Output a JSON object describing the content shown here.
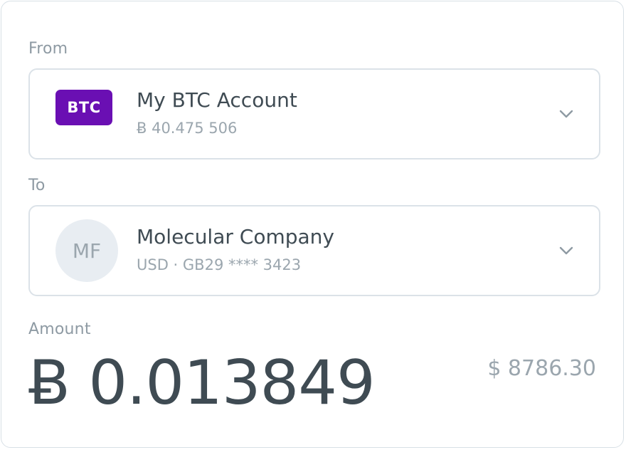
{
  "from": {
    "label": "From",
    "account_badge": "BTC",
    "account_name": "My BTC Account",
    "account_balance": "Ƀ 40.475 506",
    "chevron_icon": "chevron-down-icon"
  },
  "to": {
    "label": "To",
    "recipient_initials": "MF",
    "recipient_name": "Molecular Company",
    "recipient_details": "USD · GB29 **** 3423",
    "chevron_icon": "chevron-down-icon"
  },
  "amount": {
    "label": "Amount",
    "value": "Ƀ 0.013849",
    "fiat_equivalent": "$ 8786.30"
  },
  "colors": {
    "btc_badge": "#6a0fb3",
    "primary_text": "#3f4b53",
    "secondary_text": "#9ba6ae",
    "border": "#dbe2e8",
    "avatar_bg": "#e8edf2"
  }
}
